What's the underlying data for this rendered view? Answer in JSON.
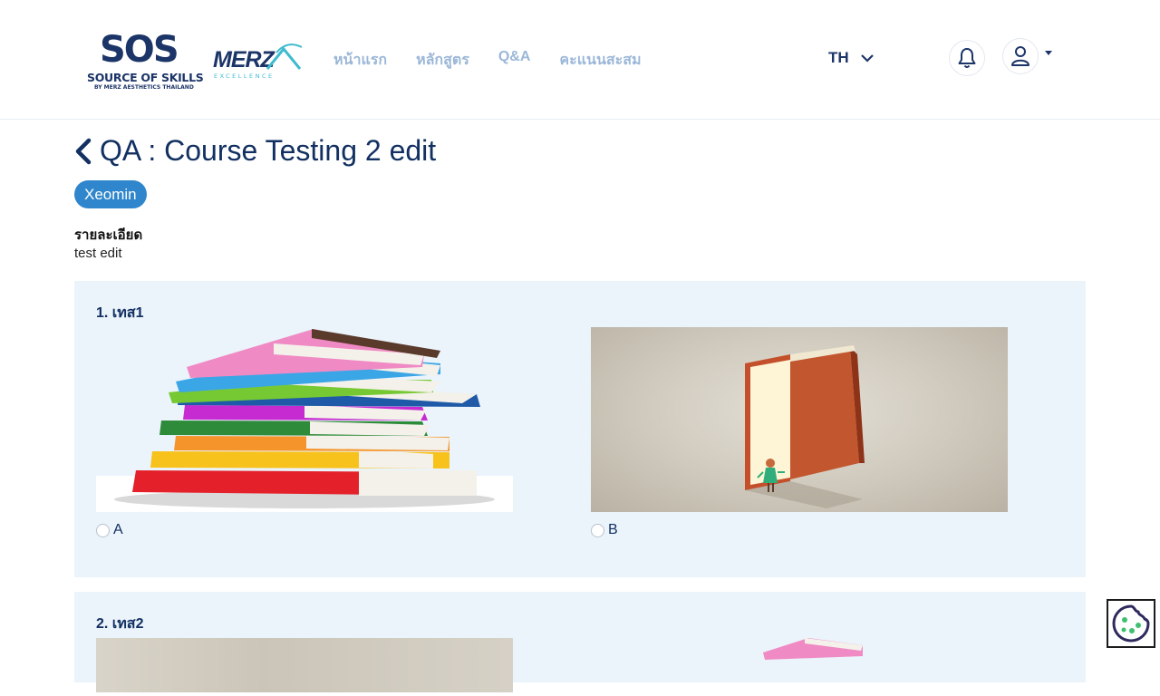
{
  "header": {
    "logo_sos": {
      "word": "SOS",
      "line1": "SOURCE OF SKILLS",
      "line2": "BY MERZ AESTHETICS THAILAND"
    },
    "logo_merz": {
      "word": "MERZ",
      "sub": "EXCELLENCE"
    },
    "nav": [
      "หน้าแรก",
      "หลักสูตร",
      "Q&A",
      "คะแนนสะสม"
    ],
    "language": "TH"
  },
  "page": {
    "title": "QA : Course Testing 2 edit",
    "badge": "Xeomin",
    "detail_label": "รายละเอียด",
    "detail_text": "test edit"
  },
  "questions": [
    {
      "title": "1. เทส1",
      "options": [
        {
          "label": "A",
          "image": "stack-of-books"
        },
        {
          "label": "B",
          "image": "open-book-door"
        }
      ]
    },
    {
      "title": "2. เทส2",
      "options": []
    }
  ],
  "colors": {
    "brand_navy": "#1c3568",
    "badge_blue": "#2f86cc",
    "panel_bg": "#ebf3fb",
    "nav_link": "#9bb7d8"
  }
}
